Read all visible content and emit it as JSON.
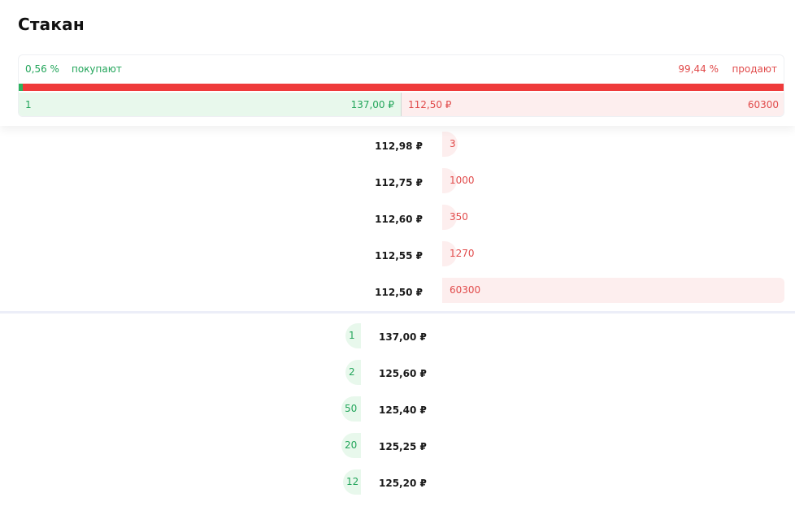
{
  "title": "Стакан",
  "summary": {
    "buy_pct": "0,56 %",
    "buy_label": "покупают",
    "sell_pct": "99,44 %",
    "sell_label": "продают",
    "buy_fraction": 0.0056,
    "best_bid_qty": "1",
    "best_bid_price": "137,00 ₽",
    "best_ask_price": "112,50 ₽",
    "best_ask_qty": "60300"
  },
  "colors": {
    "buy": "#22a55a",
    "sell": "#e14b4b",
    "buy_bg": "#e8f8ec",
    "sell_bg": "#fdeeee"
  },
  "asks": [
    {
      "price": "112,98 ₽",
      "volume": "3",
      "fraction": 4.98e-05
    },
    {
      "price": "112,75 ₽",
      "volume": "1000",
      "fraction": 0.0166
    },
    {
      "price": "112,60 ₽",
      "volume": "350",
      "fraction": 0.0058
    },
    {
      "price": "112,55 ₽",
      "volume": "1270",
      "fraction": 0.0211
    },
    {
      "price": "112,50 ₽",
      "volume": "60300",
      "fraction": 1.0
    }
  ],
  "bids": [
    {
      "volume": "1",
      "price": "137,00 ₽"
    },
    {
      "volume": "2",
      "price": "125,60 ₽"
    },
    {
      "volume": "50",
      "price": "125,40 ₽"
    },
    {
      "volume": "20",
      "price": "125,25 ₽"
    },
    {
      "volume": "12",
      "price": "125,20 ₽"
    }
  ]
}
